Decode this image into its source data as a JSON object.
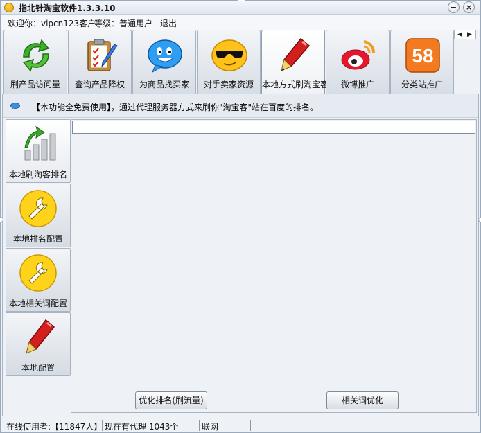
{
  "window": {
    "title": "指北针淘宝软件1.3.3.10"
  },
  "userbar": {
    "welcome": "欢迎你：vipcn123客户",
    "level": "等级：普通用户",
    "logout": "退出"
  },
  "tabs": [
    {
      "label": "刷产品访问量",
      "icon": "recycle-arrows-icon"
    },
    {
      "label": "查询产品降权",
      "icon": "clipboard-pencil-icon"
    },
    {
      "label": "为商品找买家",
      "icon": "chat-bubble-face-icon"
    },
    {
      "label": "对手卖家资源",
      "icon": "sunglasses-face-icon"
    },
    {
      "label": "本地方式刷淘宝客",
      "icon": "red-pen-icon",
      "active": true
    },
    {
      "label": "微博推广",
      "icon": "weibo-icon"
    },
    {
      "label": "分类站推广",
      "icon": "58-logo-icon"
    }
  ],
  "notice": {
    "text": "【本功能全免费使用】，通过代理服务器方式来刷你\"淘宝客\"站在百度的排名。"
  },
  "sidenav": [
    {
      "label": "本地刷淘客排名",
      "icon": "rising-bars-icon",
      "active": true
    },
    {
      "label": "本地排名配置",
      "icon": "wrench-icon"
    },
    {
      "label": "本地相关词配置",
      "icon": "wrench-icon"
    },
    {
      "label": "本地配置",
      "icon": "red-pen-icon"
    }
  ],
  "main": {
    "url_value": "",
    "optimize_button": "优化排名(刷流量)",
    "related_button": "相关词优化"
  },
  "status": {
    "online": "在线使用者:【11847人】",
    "proxies": "现在有代理 1043个",
    "network": "联网"
  },
  "colors": {
    "accent": "#8fa0b4",
    "logo58": "#f47a1f"
  }
}
